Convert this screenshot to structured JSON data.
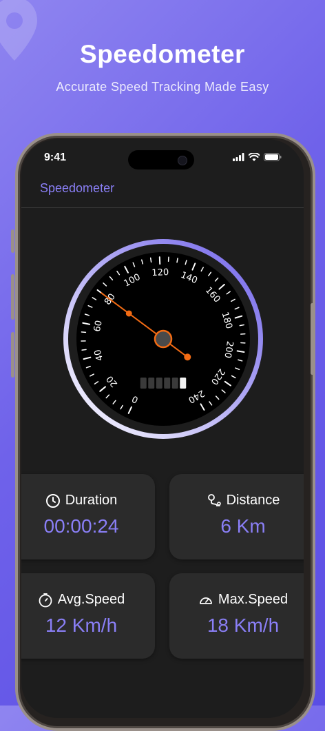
{
  "hero": {
    "title": "Speedometer",
    "subtitle": "Accurate Speed Tracking Made Easy"
  },
  "status_bar": {
    "time": "9:41",
    "icons": [
      "cellular-signal-icon",
      "wifi-icon",
      "battery-icon"
    ]
  },
  "app_bar": {
    "title": "Speedometer"
  },
  "speedometer": {
    "tick_labels": [
      "0",
      "20",
      "40",
      "60",
      "80",
      "100",
      "120",
      "140",
      "160",
      "180",
      "200",
      "220",
      "240"
    ],
    "needle_value_kmh": 80,
    "gear_indicator": {
      "segments": 6,
      "active_segment": 6
    }
  },
  "stats": {
    "duration": {
      "label": "Duration",
      "value": "00:00:24",
      "icon": "clock-icon"
    },
    "distance": {
      "label": "Distance",
      "value": "6 Km",
      "icon": "route-pin-icon"
    },
    "avg_speed": {
      "label": "Avg.Speed",
      "value": "12 Km/h",
      "icon": "stopwatch-icon"
    },
    "max_speed": {
      "label": "Max.Speed",
      "value": "18 Km/h",
      "icon": "gauge-icon"
    }
  },
  "colors": {
    "background_gradient": [
      "#8f85f0",
      "#5a4de4"
    ],
    "accent": "#8a7ff6",
    "needle": "#f26b14",
    "screen": "#1d1d1d",
    "card": "#2b2b2b"
  }
}
